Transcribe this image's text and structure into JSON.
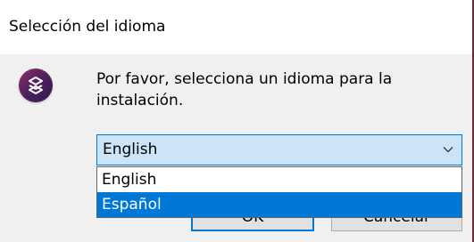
{
  "window": {
    "title": "Selección del idioma"
  },
  "dialog": {
    "message": "Por favor, selecciona un idioma para la instalación.",
    "icon": "setup-app-icon"
  },
  "language_select": {
    "selected": "English",
    "options": [
      "English",
      "Español"
    ],
    "highlighted_index": 1
  },
  "buttons": {
    "ok_label": "OK",
    "cancel_label": "Cancelar"
  },
  "colors": {
    "accent": "#0078d7",
    "selection_bg": "#cce4f7",
    "icon_gradient_start": "#8a2d64",
    "icon_gradient_end": "#2f1a4a"
  }
}
